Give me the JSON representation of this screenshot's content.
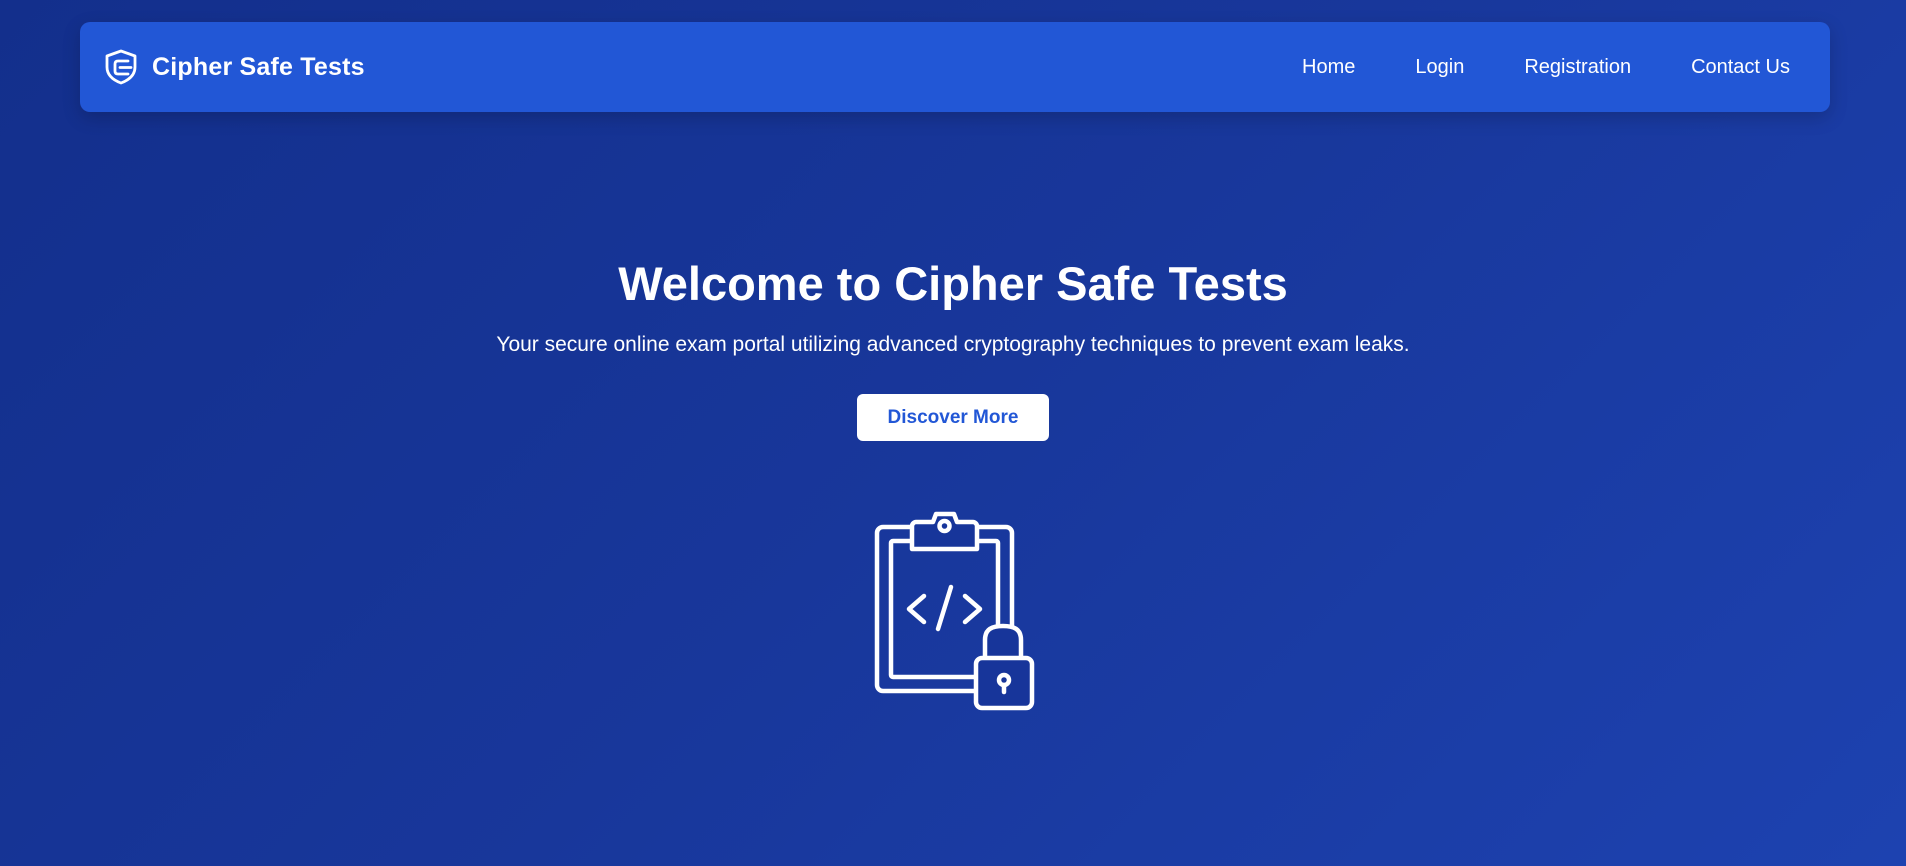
{
  "navbar": {
    "brand_icon": "shield-document-icon",
    "brand_name": "Cipher Safe Tests",
    "links": [
      {
        "label": "Home"
      },
      {
        "label": "Login"
      },
      {
        "label": "Registration"
      },
      {
        "label": "Contact Us"
      }
    ]
  },
  "hero": {
    "title": "Welcome to Cipher Safe Tests",
    "subtitle": "Your secure online exam portal utilizing advanced cryptography techniques to prevent exam leaks.",
    "cta_label": "Discover More",
    "illustration_icon": "clipboard-code-lock-icon"
  },
  "colors": {
    "background_start": "#132f8c",
    "background_end": "#1d42b0",
    "navbar": "#2257d6",
    "button_background": "#ffffff",
    "button_text": "#2257d6"
  }
}
